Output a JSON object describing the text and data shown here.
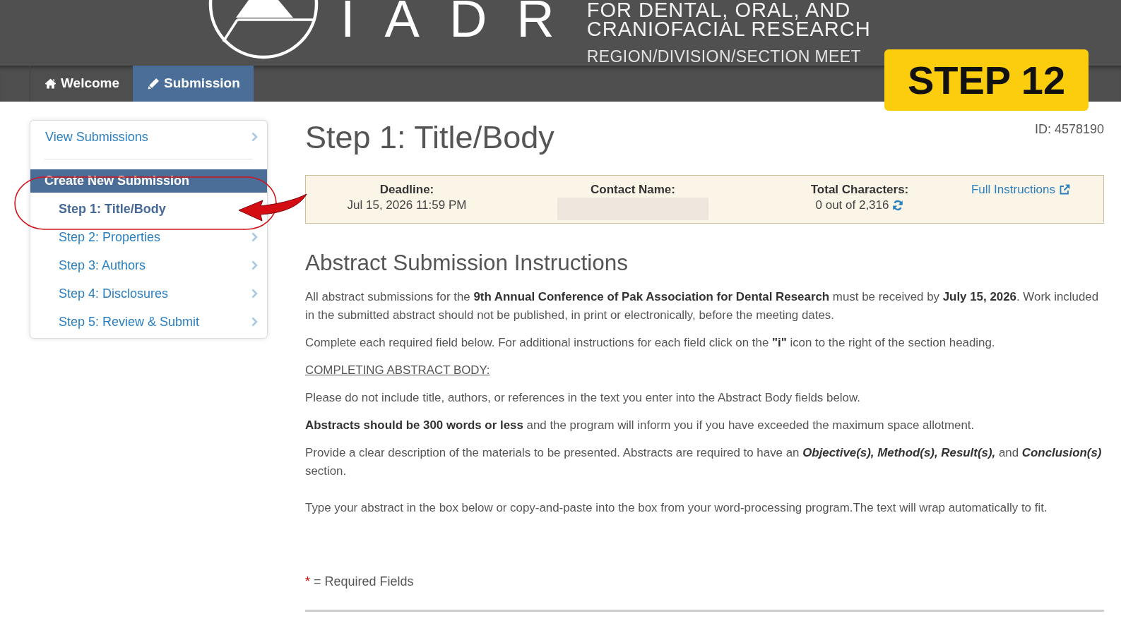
{
  "header": {
    "logo_text": "IADR",
    "org_lines": [
      "FOR DENTAL, ORAL, AND",
      "CRANIOFACIAL RESEARCH"
    ],
    "subtitle": "REGION/DIVISION/SECTION MEET"
  },
  "nav_tabs": [
    {
      "label": "Welcome",
      "selected": false
    },
    {
      "label": "Submission",
      "selected": true
    }
  ],
  "step_badge": "STEP 12",
  "sidebar": {
    "top_link": "View Submissions",
    "section_title": "Create New Submission",
    "items": [
      {
        "label": "Step 1: Title/Body",
        "selected": true
      },
      {
        "label": "Step 2: Properties",
        "selected": false
      },
      {
        "label": "Step 3: Authors",
        "selected": false
      },
      {
        "label": "Step 4: Disclosures",
        "selected": false
      },
      {
        "label": "Step 5: Review & Submit",
        "selected": false
      }
    ]
  },
  "page": {
    "title": "Step 1: Title/Body",
    "id_label": "ID: 4578190"
  },
  "info_box": {
    "deadline_label": "Deadline:",
    "deadline_value": "Jul 15, 2026 11:59 PM",
    "contact_label": "Contact Name:",
    "contact_redacted": true,
    "total_label": "Total Characters:",
    "total_value": "0 out of 2,316",
    "instructions_link": "Full Instructions"
  },
  "instructions": {
    "heading": "Abstract Submission Instructions",
    "paragraphs": [
      {
        "kind": "text",
        "text": "All abstract submissions for the **9th Annual Conference of Pak Association for Dental Research** must be received by **July 15, 2026**. Work included in the submitted abstract should not be published, in print or electronically, before the meeting dates."
      },
      {
        "kind": "text",
        "text": "Complete each required field below. For additional instructions for each field click on the **\"i\"** icon to the right of the section heading."
      },
      {
        "kind": "underlined",
        "text": "COMPLETING ABSTRACT BODY:"
      },
      {
        "kind": "text",
        "text": "Please do not include title, authors, or references in the text you enter into the Abstract Body fields below."
      },
      {
        "kind": "text",
        "text": "**Abstracts should be 300 words or less** and the program will inform you if you have exceeded the maximum space allotment."
      },
      {
        "kind": "emphasized",
        "text": "Provide a clear description of the materials to be presented. Abstracts are required to have an **Objective(s), Method(s), Result(s),** and **Conclusion(s)** section."
      },
      {
        "kind": "text",
        "text": "Type your abstract in the box below or copy-and-paste into the box from your word-processing program.The text will wrap automatically to fit."
      }
    ]
  },
  "required_note": {
    "marker": "*",
    "text": "= Required Fields"
  }
}
